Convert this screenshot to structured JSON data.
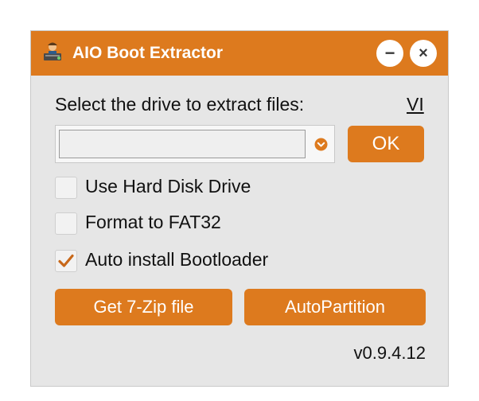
{
  "window": {
    "title": "AIO Boot Extractor",
    "minimize_symbol": "−",
    "close_symbol": "×",
    "accent_color": "#dd7a1e"
  },
  "main": {
    "prompt": "Select the drive to extract files:",
    "language_link": "VI",
    "drive_select": {
      "selected_value": ""
    },
    "ok_label": "OK",
    "checkboxes": [
      {
        "label": "Use Hard Disk Drive",
        "checked": false
      },
      {
        "label": "Format to FAT32",
        "checked": false
      },
      {
        "label": "Auto install Bootloader",
        "checked": true
      }
    ],
    "get_7zip_label": "Get 7-Zip file",
    "autopartition_label": "AutoPartition",
    "version": "v0.9.4.12"
  },
  "icons": {
    "app": "boot-extractor-icon",
    "dropdown": "chevron-down-icon",
    "check": "checkmark-icon"
  }
}
